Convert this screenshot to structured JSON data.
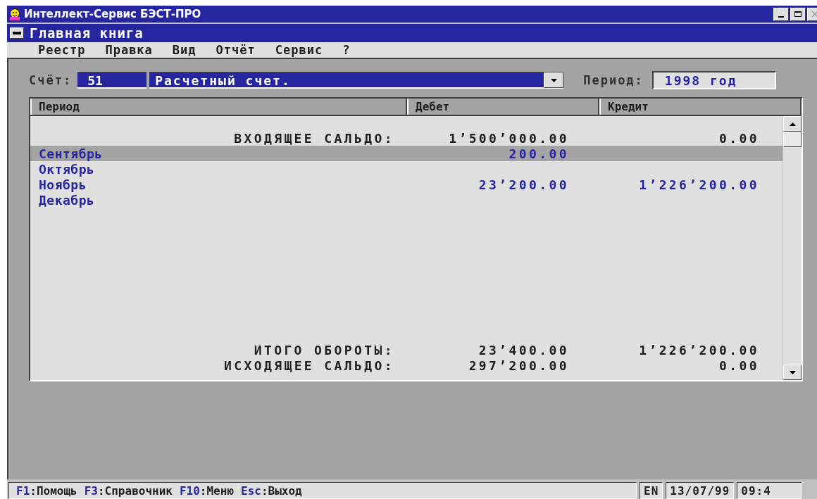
{
  "window": {
    "title": "Интеллект-Сервис БЭСТ-ПРО"
  },
  "document": {
    "title": "Главная книга"
  },
  "menu": [
    "Реестр",
    "Правка",
    "Вид",
    "Отчёт",
    "Сервис",
    "?"
  ],
  "account": {
    "label": "Счёт:",
    "number": "51",
    "name": "Расчетный счет."
  },
  "period": {
    "label": "Период:",
    "value": "1998 год"
  },
  "table": {
    "columns": [
      "Период",
      "Дебет",
      "Кредит"
    ],
    "rows": [
      {
        "kind": "summary",
        "period": "ВХОДЯЩЕЕ САЛЬДО:",
        "debit": "1’500’000.00",
        "credit": "0.00",
        "selected": false
      },
      {
        "kind": "month",
        "period": "Сентябрь",
        "debit": "200.00",
        "credit": "",
        "selected": true
      },
      {
        "kind": "month",
        "period": "Октябрь",
        "debit": "",
        "credit": "",
        "selected": false
      },
      {
        "kind": "month",
        "period": "Ноябрь",
        "debit": "23’200.00",
        "credit": "1’226’200.00",
        "selected": false
      },
      {
        "kind": "month",
        "period": "Декабрь",
        "debit": "",
        "credit": "",
        "selected": false
      }
    ],
    "totals": [
      {
        "label": "ИТОГО ОБОРОТЫ:",
        "debit": "23’400.00",
        "credit": "1’226’200.00"
      },
      {
        "label": "ИСХОДЯЩЕЕ САЛЬДО:",
        "debit": "297’200.00",
        "credit": "0.00"
      }
    ]
  },
  "status_bar": {
    "hints": [
      {
        "key": "F1",
        "label": ":Помощь"
      },
      {
        "key": "F3",
        "label": ":Справочник"
      },
      {
        "key": "F10",
        "label": ":Меню"
      },
      {
        "key": "Esc",
        "label": ":Выход"
      }
    ],
    "language": "EN",
    "date": "13/07/99",
    "time": "09:4"
  }
}
